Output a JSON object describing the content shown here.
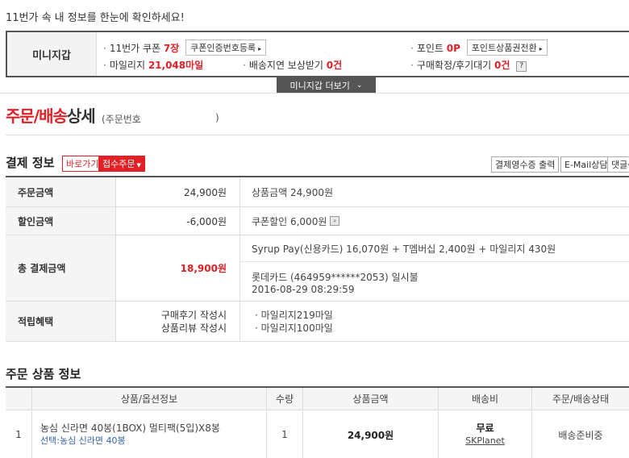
{
  "notice": "11번가 속 내 정보를 한눈에 확인하세요!",
  "wallet": {
    "title": "미니지갑",
    "coupon_label": "11번가 쿠폰",
    "coupon_count": "7장",
    "coupon_button": "쿠폰인증번호등록",
    "point_label": "포인트",
    "point_value": "0P",
    "point_button": "포인트상품권전환",
    "mileage_label": "마일리지",
    "mileage_value": "21,048마일",
    "delay_label": "배송지연 보상받기",
    "delay_value": "0건",
    "confirm_label": "구매확정/후기대기",
    "confirm_value": "0건",
    "help": "?",
    "more_button": "미니지갑 더보기"
  },
  "page": {
    "title_red": "주문/배송",
    "title_black": "상세",
    "order_no_open": "(주문번호",
    "order_no_close": ")"
  },
  "payment": {
    "title": "결제 정보",
    "btn_shortcut": "바로가기",
    "btn_receipt": "접수주문",
    "btn_receipt_print": "결제영수증 출력",
    "btn_email": "E-Mail상담",
    "btn_reply": "댓글상",
    "rows": {
      "order_amount_label": "주문금액",
      "order_amount": "24,900원",
      "order_amount_detail": "상품금액 24,900원",
      "discount_label": "할인금액",
      "discount_amount": "-6,000원",
      "discount_detail": "쿠폰할인 6,000원",
      "total_label": "총 결제금액",
      "total_amount": "18,900원",
      "total_detail_1": "Syrup Pay(신용카드) 16,070원 + T멤버십 2,400원 + 마일리지 430원",
      "total_detail_2": "롯데카드 (464959******2053) 일시불",
      "total_detail_3": "2016-08-29 08:29:59",
      "benefit_label": "적립혜택",
      "benefit_cond_1": "구매후기 작성시",
      "benefit_cond_2": "상품리뷰 작성시",
      "benefit_val_1": "마일리지219마일",
      "benefit_val_2": "마일리지100마일"
    }
  },
  "product": {
    "title": "주문 상품 정보",
    "headers": [
      "상품/옵션정보",
      "수량",
      "상품금액",
      "배송비",
      "주문/배송상태"
    ],
    "row": {
      "no": "1",
      "name": "농심 신라면 40봉(1BOX) 멀티팩(5입)X8봉",
      "option": "선택:농심 신라면 40봉",
      "qty": "1",
      "price": "24,900원",
      "shipping": "무료",
      "shipping_company": "SKPlanet",
      "status": "배송준비중"
    }
  }
}
